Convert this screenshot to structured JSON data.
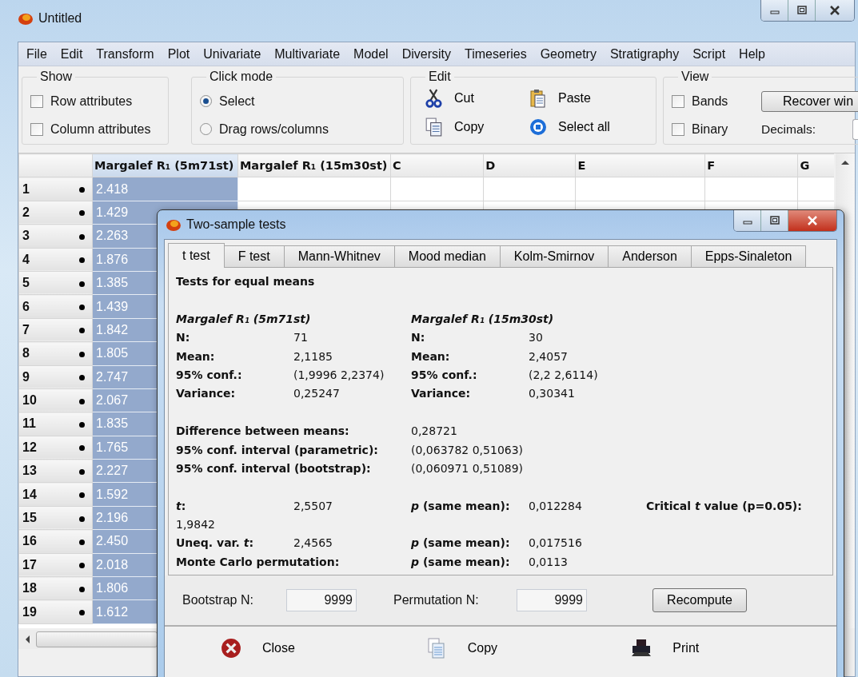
{
  "window": {
    "title": "Untitled"
  },
  "menu": [
    "File",
    "Edit",
    "Transform",
    "Plot",
    "Univariate",
    "Multivariate",
    "Model",
    "Diversity",
    "Timeseries",
    "Geometry",
    "Stratigraphy",
    "Script",
    "Help"
  ],
  "toolbar": {
    "show": {
      "label": "Show",
      "options": [
        {
          "label": "Row attributes",
          "checked": false
        },
        {
          "label": "Column attributes",
          "checked": false
        }
      ]
    },
    "click_mode": {
      "label": "Click mode",
      "options": [
        {
          "label": "Select",
          "selected": true
        },
        {
          "label": "Drag rows/columns",
          "selected": false
        }
      ]
    },
    "edit": {
      "label": "Edit",
      "actions": [
        "Cut",
        "Paste",
        "Copy",
        "Select all"
      ]
    },
    "view": {
      "label": "View",
      "options": [
        {
          "label": "Bands",
          "checked": false
        },
        {
          "label": "Binary",
          "checked": false
        }
      ],
      "button": "Recover win",
      "decimals_label": "Decimals:"
    }
  },
  "spreadsheet": {
    "columns": [
      {
        "label": "Margalef R₁ (5m71st)",
        "selected": true
      },
      {
        "label": "Margalef R₁ (15m30st)",
        "selected": false
      },
      {
        "label": "C",
        "selected": false
      },
      {
        "label": "D",
        "selected": false
      },
      {
        "label": "E",
        "selected": false
      },
      {
        "label": "F",
        "selected": false
      },
      {
        "label": "G",
        "selected": false
      }
    ],
    "rows": [
      {
        "number": "1",
        "value": "2.418"
      },
      {
        "number": "2",
        "value": "1.429"
      },
      {
        "number": "3",
        "value": "2.263"
      },
      {
        "number": "4",
        "value": "1.876"
      },
      {
        "number": "5",
        "value": "1.385"
      },
      {
        "number": "6",
        "value": "1.439"
      },
      {
        "number": "7",
        "value": "1.842"
      },
      {
        "number": "8",
        "value": "1.805"
      },
      {
        "number": "9",
        "value": "2.747"
      },
      {
        "number": "10",
        "value": "2.067"
      },
      {
        "number": "11",
        "value": "1.835"
      },
      {
        "number": "12",
        "value": "1.765"
      },
      {
        "number": "13",
        "value": "2.227"
      },
      {
        "number": "14",
        "value": "1.592"
      },
      {
        "number": "15",
        "value": "2.196"
      },
      {
        "number": "16",
        "value": "2.450"
      },
      {
        "number": "17",
        "value": "2.018"
      },
      {
        "number": "18",
        "value": "1.806"
      },
      {
        "number": "19",
        "value": "1.612"
      }
    ]
  },
  "dialog": {
    "title": "Two-sample tests",
    "tabs": [
      {
        "label": "t test",
        "selected": true
      },
      {
        "label": "F test",
        "selected": false
      },
      {
        "label": "Mann-Whitnev",
        "selected": false
      },
      {
        "label": "Mood median",
        "selected": false
      },
      {
        "label": "Kolm-Smirnov",
        "selected": false
      },
      {
        "label": "Anderson",
        "selected": false
      },
      {
        "label": "Epps-Sinaleton",
        "selected": false
      }
    ],
    "heading": "Tests for equal means",
    "samples": [
      {
        "name": "Margalef R₁ (5m71st)",
        "stats": [
          {
            "label": "N:",
            "value": "71"
          },
          {
            "label": "Mean:",
            "value": "2,1185"
          },
          {
            "label": "95% conf.:",
            "value": "(1,9996 2,2374)"
          },
          {
            "label": "Variance:",
            "value": "0,25247"
          }
        ]
      },
      {
        "name": "Margalef R₁ (15m30st)",
        "stats": [
          {
            "label": "N:",
            "value": "30"
          },
          {
            "label": "Mean:",
            "value": "2,4057"
          },
          {
            "label": "95% conf.:",
            "value": "(2,2 2,6114)"
          },
          {
            "label": "Variance:",
            "value": "0,30341"
          }
        ]
      }
    ],
    "difference": [
      {
        "label": "Difference between means:",
        "value": "0,28721"
      },
      {
        "label": "95% conf. interval (parametric):",
        "value": "(0,063782 0,51063)"
      },
      {
        "label": "95% conf. interval (bootstrap):",
        "value": "(0,060971 0,51089)"
      }
    ],
    "tests": [
      {
        "label": "*t*:",
        "value": "2,5507",
        "p_label": "*p* (same mean):",
        "p_value": "0,012284",
        "critical_label": "Critical *t* value (p=0.05):",
        "critical_value": "1,9842"
      },
      {
        "label": "Uneq. var. *t*:",
        "value": "2,4565",
        "p_label": "*p* (same mean):",
        "p_value": "0,017516"
      },
      {
        "label": "Monte Carlo permutation:",
        "p_label": "*p* (same mean):",
        "p_value": "0,0113"
      }
    ],
    "parameters": [
      {
        "label": "Bootstrap N:",
        "value": "9999"
      },
      {
        "label": "Permutation N:",
        "value": "9999"
      }
    ],
    "recompute": "Recompute",
    "buttons": [
      "Close",
      "Copy",
      "Print"
    ]
  }
}
